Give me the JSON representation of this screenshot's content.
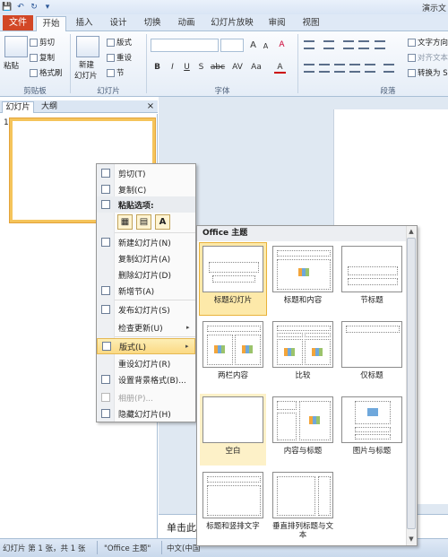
{
  "quick_access": {
    "save": "💾",
    "undo": "↶",
    "redo": "↻",
    "customize": "▾"
  },
  "window_title": "演示文",
  "tabs": {
    "file": "文件",
    "items": [
      "开始",
      "插入",
      "设计",
      "切换",
      "动画",
      "幻灯片放映",
      "审阅",
      "视图"
    ],
    "active": "开始"
  },
  "ribbon": {
    "clipboard": {
      "paste": "粘贴",
      "cut": "剪切",
      "copy": "复制",
      "format_painter": "格式刷",
      "label": "剪贴板"
    },
    "slides": {
      "new_slide_line1": "新建",
      "new_slide_line2": "幻灯片",
      "layout": "版式",
      "reset": "重设",
      "section": "节",
      "label": "幻灯片"
    },
    "font": {
      "label": "字体",
      "grow": "A",
      "shrink": "A",
      "clear": "A",
      "bold": "B",
      "italic": "I",
      "underline": "U",
      "strike": "S",
      "shadow": "abc",
      "spacing": "AV",
      "case": "Aa",
      "color": "A"
    },
    "paragraph": {
      "label": "段落",
      "text_direction": "文字方向",
      "align_text": "对齐文本",
      "convert": "转换为 S"
    }
  },
  "panel": {
    "tab_slides": "幻灯片",
    "tab_outline": "大纲",
    "close": "×",
    "slide_number": "1"
  },
  "notes_placeholder": "单击此",
  "status": {
    "slide_info": "幻灯片 第 1 张，共 1 张",
    "theme": "\"Office 主题\"",
    "language": "中文(中国"
  },
  "context_menu": {
    "items": [
      {
        "icon": "scissors-icon",
        "label": "剪切(T)"
      },
      {
        "icon": "copy-icon",
        "label": "复制(C)"
      },
      {
        "icon": "clipboard-icon",
        "label": "粘贴选项:"
      },
      {
        "icon": "new-slide-icon",
        "label": "新建幻灯片(N)"
      },
      {
        "icon": "duplicate-icon",
        "label": "复制幻灯片(A)"
      },
      {
        "icon": "delete-icon",
        "label": "删除幻灯片(D)"
      },
      {
        "icon": "section-icon",
        "label": "新增节(A)"
      },
      {
        "icon": "publish-icon",
        "label": "发布幻灯片(S)"
      },
      {
        "icon": "none",
        "label": "检查更新(U)"
      },
      {
        "icon": "layout-icon",
        "label": "版式(L)"
      },
      {
        "icon": "none",
        "label": "重设幻灯片(R)"
      },
      {
        "icon": "background-icon",
        "label": "设置背景格式(B)..."
      },
      {
        "icon": "photo-album-icon",
        "label": "相册(P)..."
      },
      {
        "icon": "hide-slide-icon",
        "label": "隐藏幻灯片(H)"
      }
    ],
    "paste_options": [
      "▦",
      "▤",
      "A"
    ],
    "submenu_arrow": "▸"
  },
  "gallery": {
    "title": "Office 主题",
    "scroll_up": "▲",
    "scroll_down": "▼",
    "layouts": [
      {
        "label": "标题幻灯片"
      },
      {
        "label": "标题和内容"
      },
      {
        "label": "节标题"
      },
      {
        "label": "两栏内容"
      },
      {
        "label": "比较"
      },
      {
        "label": "仅标题"
      },
      {
        "label": "空白"
      },
      {
        "label": "内容与标题"
      },
      {
        "label": "图片与标题"
      },
      {
        "label": "标题和竖排文字"
      },
      {
        "label": "垂直排列标题与文本"
      }
    ],
    "selected": "标题幻灯片",
    "hovered": "空白"
  }
}
